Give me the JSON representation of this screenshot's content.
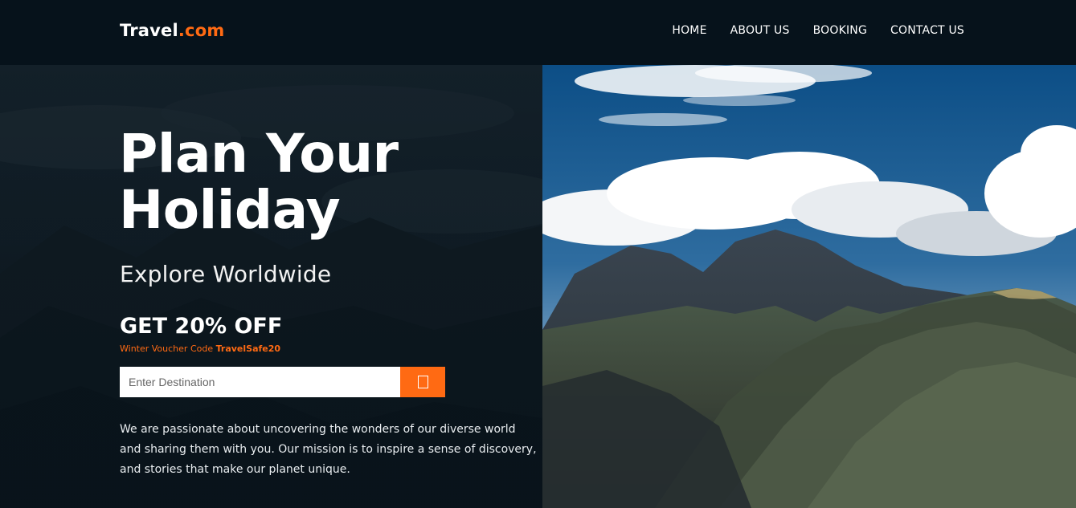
{
  "header": {
    "logo_brand": "Travel",
    "logo_tld": ".com",
    "nav": [
      "HOME",
      "ABOUT US",
      "BOOKING",
      "CONTACT US"
    ]
  },
  "hero": {
    "headline_line1": "Plan Your",
    "headline_line2": "Holiday",
    "subline": "Explore Worldwide",
    "offer": "GET 20% OFF",
    "voucher_label": "Winter Voucher Code ",
    "voucher_code": "TravelSafe20",
    "search_placeholder": "Enter Destination",
    "search_icon": "search-icon",
    "description": "We are passionate about uncovering the wonders of our diverse world and sharing them with you. Our mission is to inspire a sense of discovery, and stories that make our planet unique."
  },
  "colors": {
    "accent": "#ff6a13",
    "header_bg": "#06121b",
    "text": "#ffffff"
  }
}
